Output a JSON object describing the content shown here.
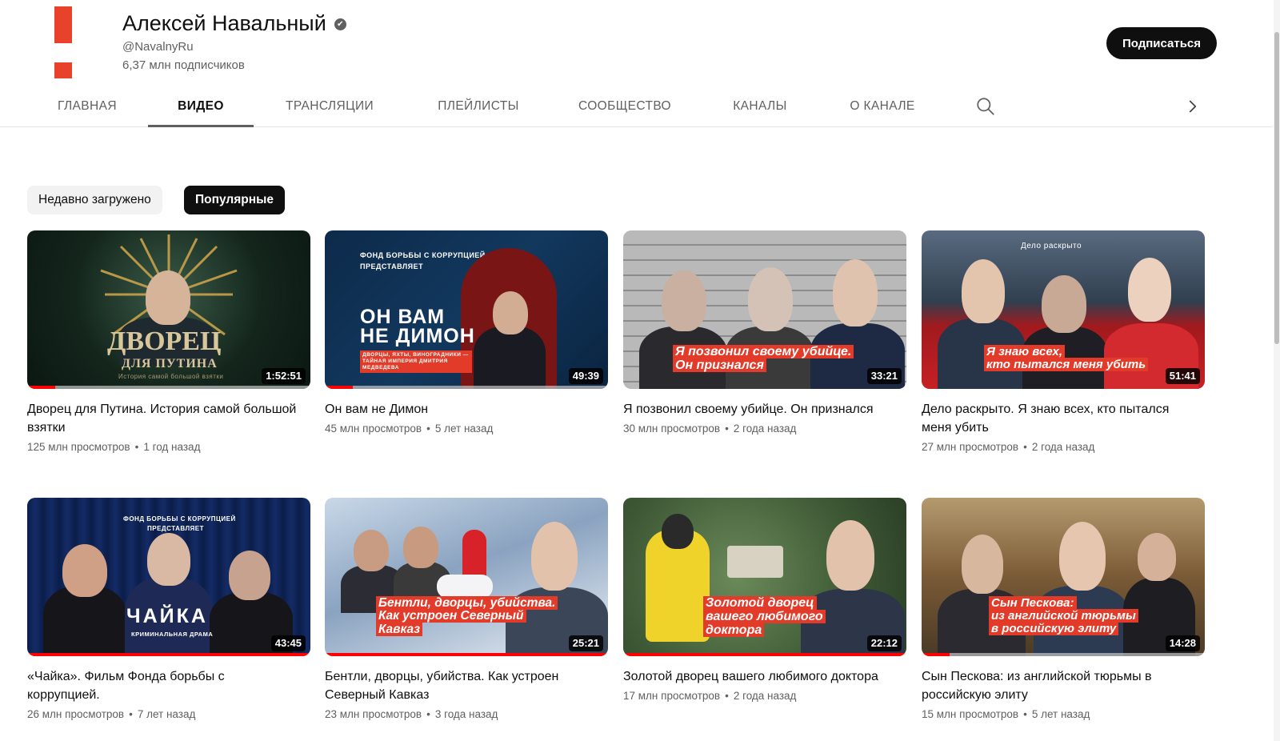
{
  "channel": {
    "name": "Алексей Навальный",
    "verified_icon": "✔",
    "handle": "@NavalnyRu",
    "subscribers": "6,37 млн подписчиков",
    "subscribe_label": "Подписаться",
    "brand_color": "#e8422a"
  },
  "tabs": [
    {
      "label": "ГЛАВНАЯ",
      "active": false
    },
    {
      "label": "ВИДЕО",
      "active": true
    },
    {
      "label": "ТРАНСЛЯЦИИ",
      "active": false
    },
    {
      "label": "ПЛЕЙЛИСТЫ",
      "active": false
    },
    {
      "label": "СООБЩЕСТВО",
      "active": false
    },
    {
      "label": "КАНАЛЫ",
      "active": false
    },
    {
      "label": "О КАНАЛЕ",
      "active": false
    }
  ],
  "icons": {
    "search": "search-icon",
    "next": "chevron-right-icon"
  },
  "chips": [
    {
      "label": "Недавно загружено",
      "active": false
    },
    {
      "label": "Популярные",
      "active": true
    }
  ],
  "videos": [
    {
      "title": "Дворец для Путина. История самой большой взятки",
      "views": "125 млн просмотров",
      "age": "1 год назад",
      "duration": "1:52:51",
      "watched": 0.1,
      "thumb": {
        "big_title": "ДВОРЕЦ",
        "big_sub": "ДЛЯ ПУТИНА",
        "small": "История самой большой взятки"
      }
    },
    {
      "title": "Он вам не Димон",
      "views": "45 млн просмотров",
      "age": "5 лет назад",
      "duration": "49:39",
      "watched": 0.1,
      "thumb": {
        "top": "ФОНД БОРЬБЫ С КОРРУПЦИЕЙ",
        "top2": "ПРЕДСТАВЛЯЕТ",
        "big_title": "ОН ВАМ",
        "big_sub": "НЕ ДИМОН",
        "small": "ДВОРЦЫ, ЯХТЫ, ВИНОГРАДНИКИ — ТАЙНАЯ ИМПЕРИЯ ДМИТРИЯ МЕДВЕДЕВА"
      }
    },
    {
      "title": "Я позвонил своему убийце. Он признался",
      "views": "30 млн просмотров",
      "age": "2 года назад",
      "duration": "33:21",
      "watched": 0,
      "thumb": {
        "headline_1": "Я позвонил своему убийце.",
        "headline_2": "Он признался"
      }
    },
    {
      "title": "Дело раскрыто. Я знаю всех, кто пытался меня убить",
      "views": "27 млн просмотров",
      "age": "2 года назад",
      "duration": "51:41",
      "watched": 0,
      "thumb": {
        "top": "Дело раскрыто",
        "headline_1": "Я знаю всех,",
        "headline_2": "кто пытался меня убить"
      }
    },
    {
      "title": "«Чайка». Фильм Фонда борьбы с коррупцией.",
      "views": "26 млн просмотров",
      "age": "7 лет назад",
      "duration": "43:45",
      "watched": 1.0,
      "thumb": {
        "top": "ФОНД БОРЬБЫ С КОРРУПЦИЕЙ",
        "top2": "ПРЕДСТАВЛЯЕТ",
        "big_title": "ЧАЙКА",
        "small": "КРИМИНАЛЬНАЯ ДРАМА"
      }
    },
    {
      "title": "Бентли, дворцы, убийства. Как устроен Северный Кавказ",
      "views": "23 млн просмотров",
      "age": "3 года назад",
      "duration": "25:21",
      "watched": 1.0,
      "thumb": {
        "headline_1": "Бентли, дворцы, убийства.",
        "headline_2": "Как устроен Северный",
        "headline_3": "Кавказ"
      }
    },
    {
      "title": "Золотой дворец вашего любимого доктора",
      "views": "17 млн просмотров",
      "age": "2 года назад",
      "duration": "22:12",
      "watched": 1.0,
      "thumb": {
        "headline_1": "Золотой дворец",
        "headline_2": "вашего любимого",
        "headline_3": "доктора"
      }
    },
    {
      "title": "Сын Пескова: из английской тюрьмы в российскую элиту",
      "views": "15 млн просмотров",
      "age": "5 лет назад",
      "duration": "14:28",
      "watched": 0.1,
      "thumb": {
        "headline_1": "Сын Пескова:",
        "headline_2": "из английской тюрьмы",
        "headline_3": "в российскую элиту"
      }
    }
  ]
}
